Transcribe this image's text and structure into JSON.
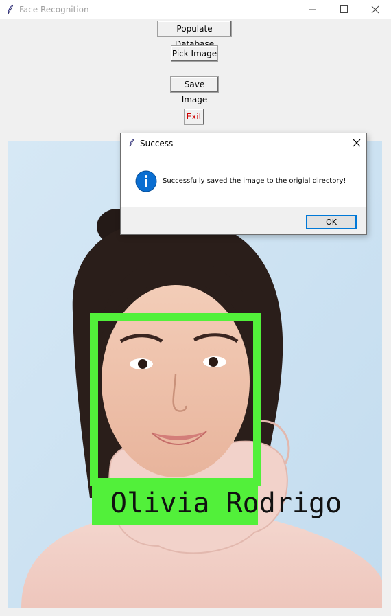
{
  "window": {
    "title": "Face Recognition",
    "icon": "feather-icon"
  },
  "buttons": {
    "populate": "Populate Database",
    "pick": "Pick Image",
    "save": "Save Image",
    "exit": "Exit",
    "exit_color": "#cc0000"
  },
  "photo": {
    "label": "Olivia Rodrigo",
    "box_color": "#52f03a"
  },
  "dialog": {
    "title": "Success",
    "message": "Successfully saved the image to the origial directory!",
    "icon": "info-icon",
    "ok_label": "OK"
  }
}
